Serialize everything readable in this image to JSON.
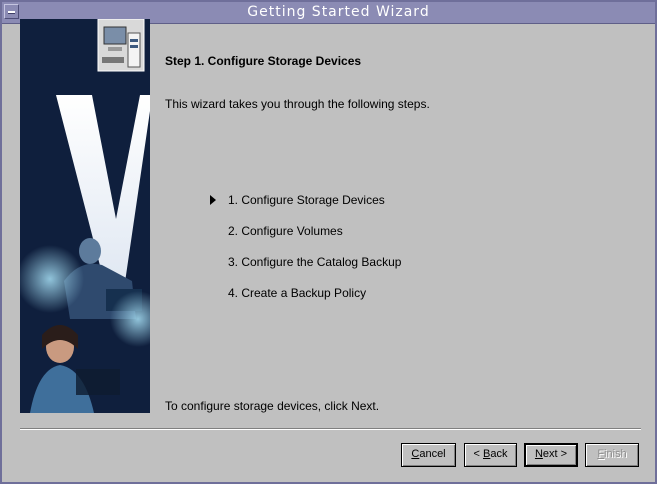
{
  "window": {
    "title": "Getting Started Wizard"
  },
  "header": {
    "step_title": "Step 1. Configure Storage Devices",
    "intro": "This wizard takes you through the following steps."
  },
  "steps": [
    {
      "label": "1.  Configure Storage Devices",
      "current": true
    },
    {
      "label": "2.  Configure Volumes",
      "current": false
    },
    {
      "label": "3.  Configure the Catalog Backup",
      "current": false
    },
    {
      "label": "4.  Create a Backup Policy",
      "current": false
    }
  ],
  "footer": {
    "instruction": "To configure storage devices, click Next."
  },
  "buttons": {
    "cancel": {
      "prefix": "",
      "mnemonic": "C",
      "rest": "ancel",
      "enabled": true
    },
    "back": {
      "prefix": "< ",
      "mnemonic": "B",
      "rest": "ack",
      "enabled": true
    },
    "next": {
      "prefix": "",
      "mnemonic": "N",
      "rest": "ext >",
      "enabled": true
    },
    "finish": {
      "prefix": "",
      "mnemonic": "F",
      "rest": "inish",
      "enabled": false
    }
  },
  "colors": {
    "titlebar": "#8b8bb4",
    "window_bg": "#c0c0c0",
    "disabled_text": "#8e8e8e"
  },
  "icons": {
    "window_menu": "window-menu-icon",
    "step_marker": "triangle-right-icon",
    "wizard_art": "computer-icon"
  }
}
